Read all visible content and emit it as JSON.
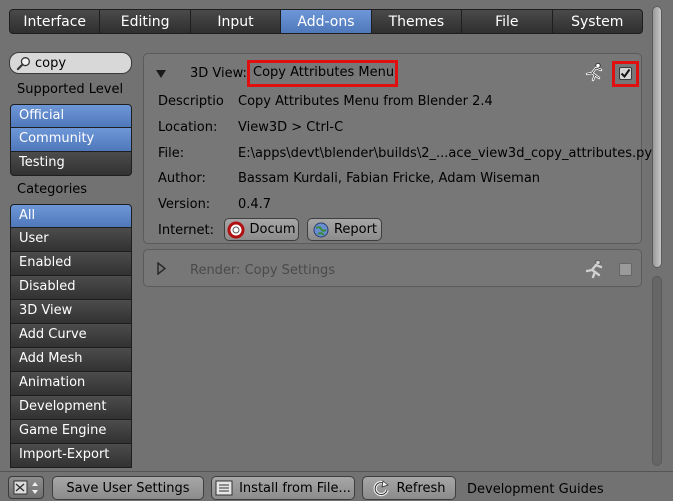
{
  "tabs": [
    {
      "label": "Interface",
      "active": false
    },
    {
      "label": "Editing",
      "active": false
    },
    {
      "label": "Input",
      "active": false
    },
    {
      "label": "Add-ons",
      "active": true
    },
    {
      "label": "Themes",
      "active": false
    },
    {
      "label": "File",
      "active": false
    },
    {
      "label": "System",
      "active": false
    }
  ],
  "search": {
    "value": "copy",
    "icon": "search-icon"
  },
  "sidebar": {
    "support_heading": "Supported Level",
    "support_levels": [
      {
        "label": "Official",
        "selected": true
      },
      {
        "label": "Community",
        "selected": true
      },
      {
        "label": "Testing",
        "selected": false
      }
    ],
    "categories_heading": "Categories",
    "categories": [
      {
        "label": "All",
        "selected": true
      },
      {
        "label": "User",
        "selected": false
      },
      {
        "label": "Enabled",
        "selected": false
      },
      {
        "label": "Disabled",
        "selected": false
      },
      {
        "label": "3D View",
        "selected": false
      },
      {
        "label": "Add Curve",
        "selected": false
      },
      {
        "label": "Add Mesh",
        "selected": false
      },
      {
        "label": "Animation",
        "selected": false
      },
      {
        "label": "Development",
        "selected": false
      },
      {
        "label": "Game Engine",
        "selected": false
      },
      {
        "label": "Import-Export",
        "selected": false
      }
    ]
  },
  "addon1": {
    "title_prefix": "3D View:",
    "title_name": "Copy Attributes Menu",
    "enabled": true,
    "details": [
      {
        "key": "Descriptio",
        "value": "Copy Attributes Menu from Blender 2.4"
      },
      {
        "key": "Location:",
        "value": "View3D > Ctrl-C"
      },
      {
        "key": "File:",
        "value": "E:\\apps\\devt\\blender\\builds\\2_...ace_view3d_copy_attributes.py"
      },
      {
        "key": "Author:",
        "value": "Bassam Kurdali, Fabian Fricke, Adam Wiseman"
      },
      {
        "key": "Version:",
        "value": "0.4.7"
      }
    ],
    "internet_label": "Internet:",
    "doc_button": "Docum",
    "report_button": "Report"
  },
  "addon2": {
    "title": "Render: Copy Settings",
    "enabled": false
  },
  "bottom": {
    "save_label": "Save User Settings",
    "install_label": "Install from File...",
    "refresh_label": "Refresh",
    "guides_label": "Development Guides"
  },
  "colors": {
    "accent": "#5b85c8",
    "highlight_box": "#e01010",
    "background": "#727272"
  }
}
